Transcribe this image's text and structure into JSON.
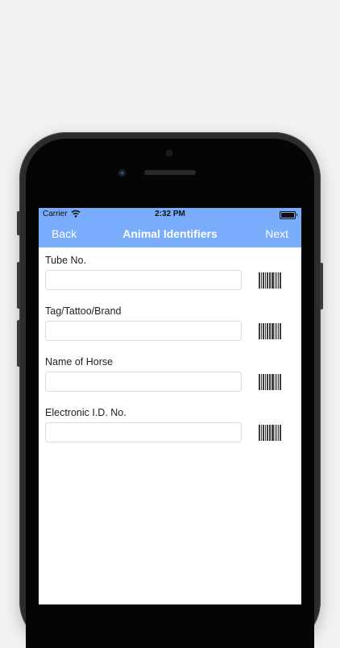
{
  "status_bar": {
    "carrier": "Carrier",
    "time": "2:32 PM"
  },
  "nav": {
    "back_label": "Back",
    "title": "Animal Identifiers",
    "next_label": "Next"
  },
  "fields": [
    {
      "label": "Tube No.",
      "value": "",
      "placeholder": ""
    },
    {
      "label": "Tag/Tattoo/Brand",
      "value": "",
      "placeholder": ""
    },
    {
      "label": "Name of Horse",
      "value": "",
      "placeholder": ""
    },
    {
      "label": "Electronic I.D. No.",
      "value": "",
      "placeholder": ""
    }
  ],
  "icons": {
    "scan": "barcode-icon",
    "wifi": "wifi-icon",
    "battery": "battery-icon"
  },
  "colors": {
    "nav_background": "#79acfa",
    "nav_text": "#ffffff",
    "page_background": "#f2f2f4",
    "phone_frame": "#2c2c2e"
  }
}
